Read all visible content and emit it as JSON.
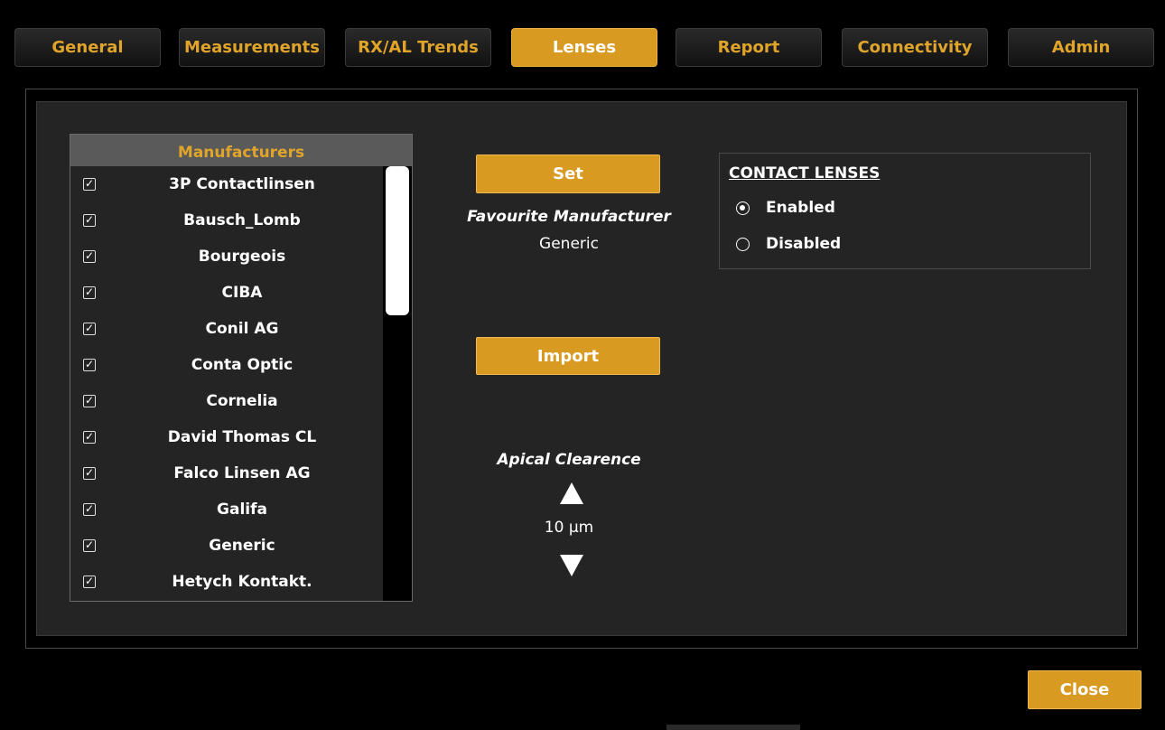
{
  "tabs": [
    {
      "label": "General",
      "active": false
    },
    {
      "label": "Measurements",
      "active": false
    },
    {
      "label": "RX/AL Trends",
      "active": false
    },
    {
      "label": "Lenses",
      "active": true
    },
    {
      "label": "Report",
      "active": false
    },
    {
      "label": "Connectivity",
      "active": false
    },
    {
      "label": "Admin",
      "active": false
    }
  ],
  "manufacturers": {
    "header": "Manufacturers",
    "items": [
      {
        "name": "3P Contactlinsen",
        "checked": true
      },
      {
        "name": "Bausch_Lomb",
        "checked": true
      },
      {
        "name": "Bourgeois",
        "checked": true
      },
      {
        "name": "CIBA",
        "checked": true
      },
      {
        "name": "Conil AG",
        "checked": true
      },
      {
        "name": "Conta Optic",
        "checked": true
      },
      {
        "name": "Cornelia",
        "checked": true
      },
      {
        "name": "David Thomas CL",
        "checked": true
      },
      {
        "name": "Falco Linsen AG",
        "checked": true
      },
      {
        "name": "Galifa",
        "checked": true
      },
      {
        "name": "Generic",
        "checked": true
      },
      {
        "name": "Hetych Kontakt.",
        "checked": true
      }
    ]
  },
  "favourite": {
    "set_label": "Set",
    "title": "Favourite Manufacturer",
    "value": "Generic"
  },
  "import_label": "Import",
  "apical": {
    "title": "Apical Clearence",
    "value": "10 µm"
  },
  "contact_lenses": {
    "title": "CONTACT LENSES",
    "options": [
      {
        "label": "Enabled",
        "selected": true
      },
      {
        "label": "Disabled",
        "selected": false
      }
    ]
  },
  "close_label": "Close",
  "colors": {
    "accent": "#d99a22",
    "tab_text": "#e0a42a",
    "panel_bg": "#242424",
    "background": "#000000"
  }
}
